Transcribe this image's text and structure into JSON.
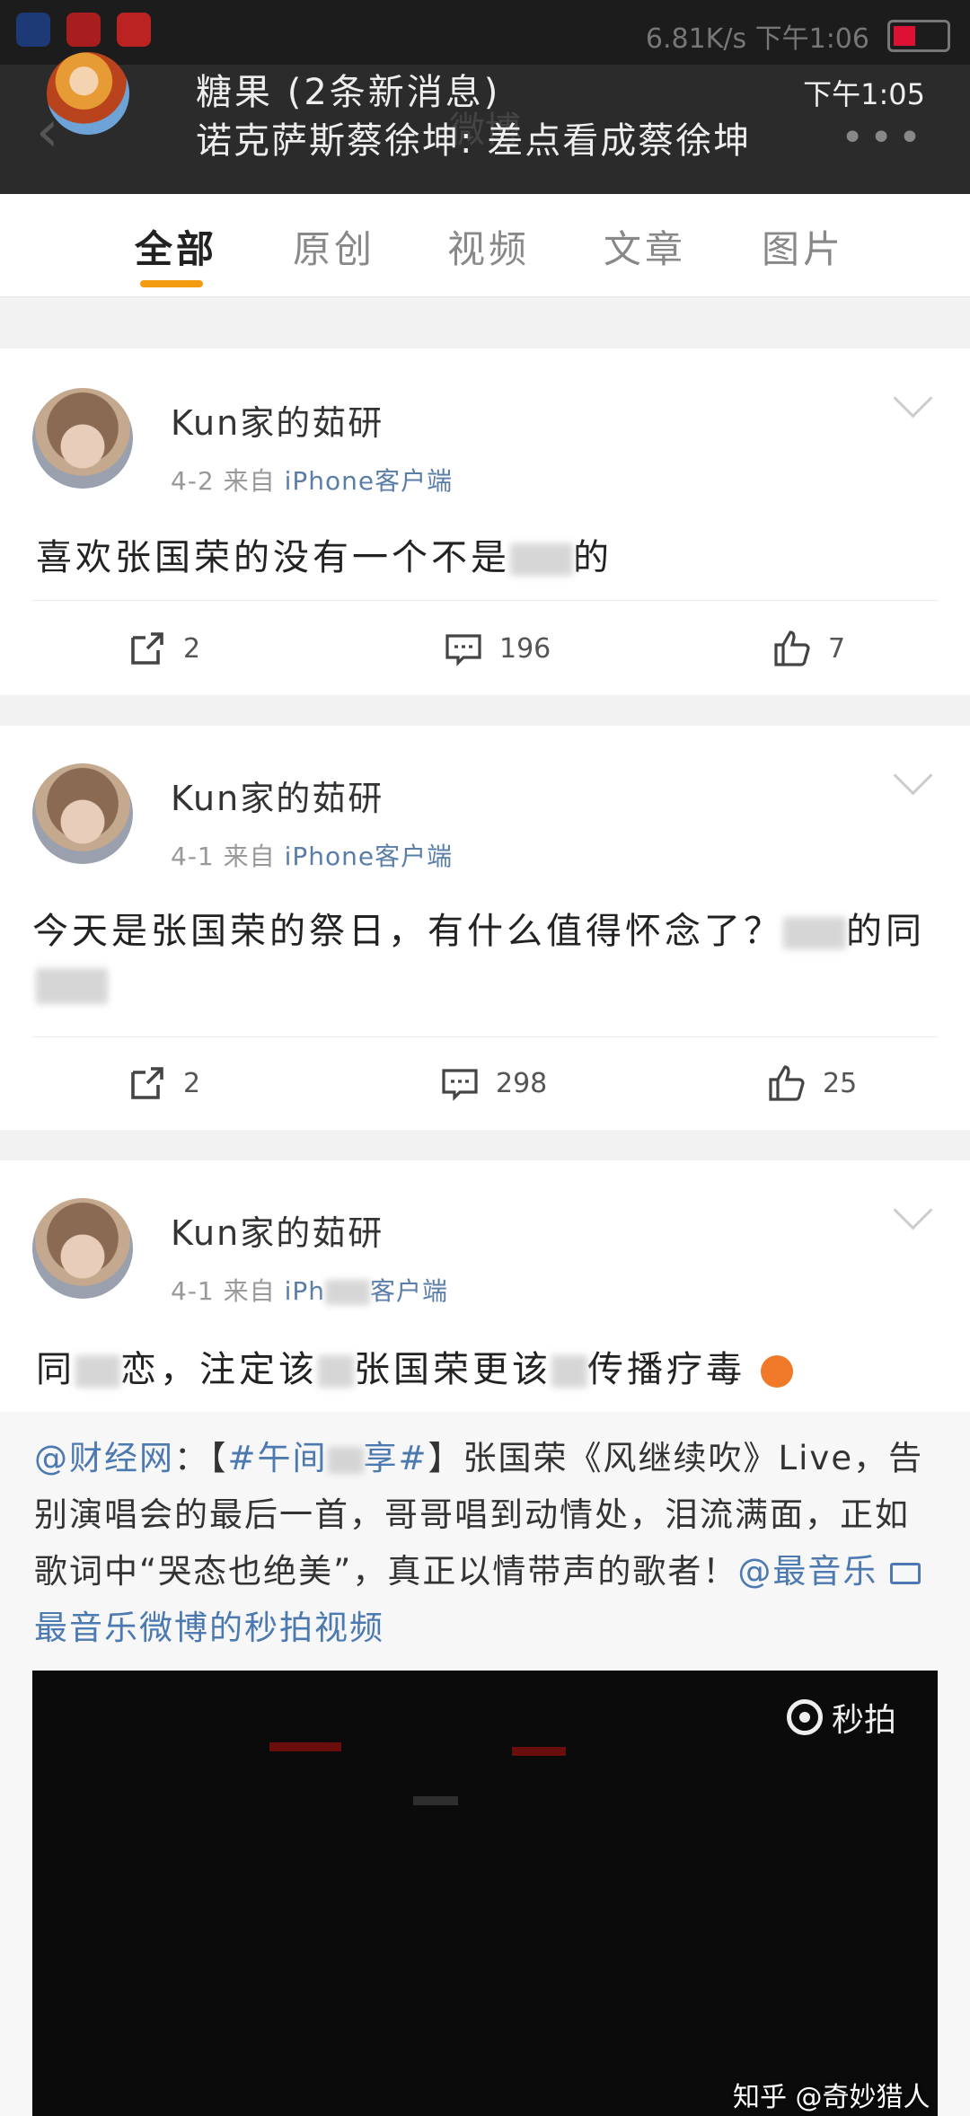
{
  "notification": {
    "title": "糖果 (2条新消息)",
    "message": "诺克萨斯蔡徐坤: 差点看成蔡徐坤",
    "time": "下午1:05",
    "status_right": "6.81K/s  下午1:06"
  },
  "underlying_title": "微博",
  "tabs": [
    "全部",
    "原创",
    "视频",
    "文章",
    "图片"
  ],
  "active_tab": "全部",
  "posts": [
    {
      "username": "Kun家的茹研",
      "date": "4-2",
      "source_prefix": "来自",
      "source": "iPhone客户端",
      "text": "喜欢张国荣的没有一个不是",
      "text_tail": "的",
      "shares": "2",
      "comments": "196",
      "likes": "7"
    },
    {
      "username": "Kun家的茹研",
      "date": "4-1",
      "source_prefix": "来自",
      "source": "iPhone客户端",
      "text": "今天是张国荣的祭日，有什么值得怀念了？",
      "text_tail": "的同",
      "shares": "2",
      "comments": "298",
      "likes": "25"
    },
    {
      "username": "Kun家的茹研",
      "date": "4-1",
      "source_prefix": "来自",
      "source": "iPh",
      "source_tail": "客户端",
      "text": "同",
      "text_b": "恋，注定该",
      "text_c": "张国荣更该",
      "text_d": "传播疗毒"
    }
  ],
  "repost": {
    "mention": "@财经网",
    "sep": "：【",
    "hashtag": "#午间",
    "hashtag_tail": "享#",
    "body": "】张国荣《风继续吹》Live，告别演唱会的最后一首，哥哥唱到动情处，泪流满面，正如歌词中“哭态也绝美”，真正以情带声的歌者！",
    "mention2": "@最音乐",
    "video_link": "最音乐微博的秒拍视频",
    "video_badge": "秒拍"
  },
  "watermark": "知乎 @奇妙猎人",
  "colors": {
    "accent": "#f39c12",
    "link": "#4b79b0",
    "notification_bg": "#2b2b2b"
  }
}
